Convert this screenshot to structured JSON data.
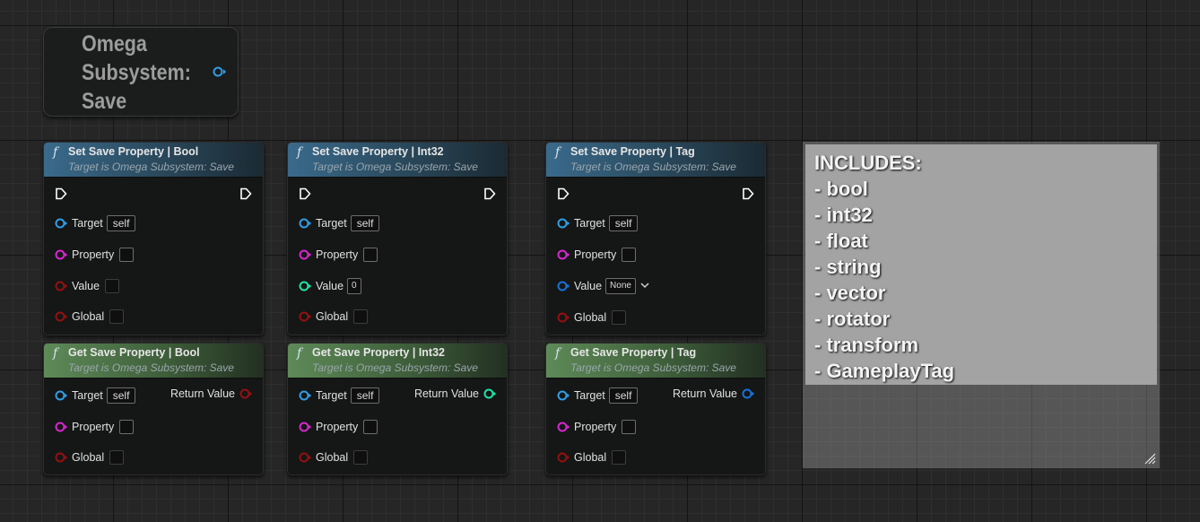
{
  "variable_node": {
    "title": "Omega Subsystem: Save"
  },
  "colors": {
    "object": "#2f9ee6",
    "name": "#d627d0",
    "bool": "#951010",
    "int": "#1fe3a7",
    "struct": "#1772d9",
    "exec": "#ffffff"
  },
  "nodes": [
    {
      "kind": "set",
      "title": "Set Save Property | Bool",
      "subtitle": "Target is Omega Subsystem: Save",
      "icon": "function-icon",
      "target_label": "Target",
      "target_value": "self",
      "property_label": "Property",
      "value_label": "Value",
      "global_label": "Global"
    },
    {
      "kind": "set",
      "title": "Set Save Property | Int32",
      "subtitle": "Target is Omega Subsystem: Save",
      "icon": "function-icon",
      "target_label": "Target",
      "target_value": "self",
      "property_label": "Property",
      "value_label": "Value",
      "value_default": "0",
      "global_label": "Global"
    },
    {
      "kind": "set",
      "title": "Set Save Property | Tag",
      "subtitle": "Target is Omega Subsystem: Save",
      "icon": "function-icon",
      "target_label": "Target",
      "target_value": "self",
      "property_label": "Property",
      "value_label": "Value",
      "value_default": "None",
      "global_label": "Global"
    },
    {
      "kind": "get",
      "title": "Get Save Property | Bool",
      "subtitle": "Target is Omega Subsystem: Save",
      "icon": "function-icon",
      "target_label": "Target",
      "target_value": "self",
      "property_label": "Property",
      "global_label": "Global",
      "return_label": "Return Value"
    },
    {
      "kind": "get",
      "title": "Get Save Property | Int32",
      "subtitle": "Target is Omega Subsystem: Save",
      "icon": "function-icon",
      "target_label": "Target",
      "target_value": "self",
      "property_label": "Property",
      "global_label": "Global",
      "return_label": "Return Value"
    },
    {
      "kind": "get",
      "title": "Get Save Property | Tag",
      "subtitle": "Target is Omega Subsystem: Save",
      "icon": "function-icon",
      "target_label": "Target",
      "target_value": "self",
      "property_label": "Property",
      "global_label": "Global",
      "return_label": "Return Value"
    }
  ],
  "function_symbol": "f",
  "comment": {
    "lines": [
      "INCLUDES:",
      "- bool",
      "- int32",
      "- float",
      "- string",
      "- vector",
      "- rotator",
      "- transform",
      "- GameplayTag"
    ]
  }
}
